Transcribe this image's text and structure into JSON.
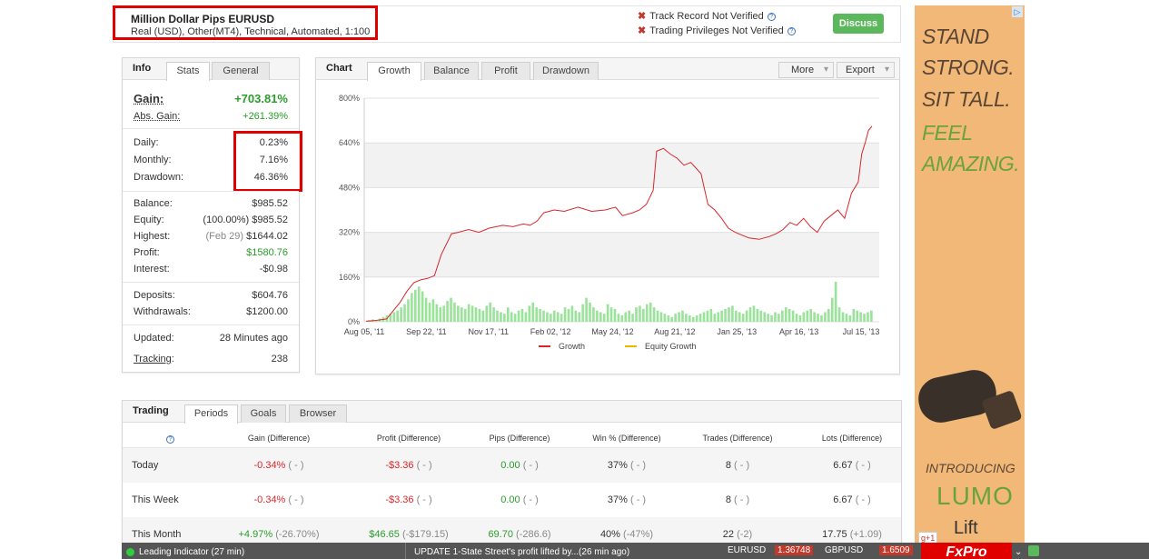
{
  "header": {
    "account_name": "Million Dollar Pips EURUSD",
    "account_details": "Real (USD), Other(MT4), Technical, Automated, 1:100",
    "track_record": "Track Record Not Verified",
    "trading_privileges": "Trading Privileges Not Verified",
    "discuss_label": "Discuss"
  },
  "info": {
    "title": "Info",
    "tabs": [
      "Stats",
      "General"
    ],
    "gain_label": "Gain:",
    "gain_value": "+703.81%",
    "abs_gain_label": "Abs. Gain:",
    "abs_gain_value": "+261.39%",
    "daily_label": "Daily:",
    "daily_value": "0.23%",
    "monthly_label": "Monthly:",
    "monthly_value": "7.16%",
    "drawdown_label": "Drawdown:",
    "drawdown_value": "46.36%",
    "balance_label": "Balance:",
    "balance_value": "$985.52",
    "equity_label": "Equity:",
    "equity_pct": "(100.00%)",
    "equity_value": "$985.52",
    "highest_label": "Highest:",
    "highest_date": "(Feb 29)",
    "highest_value": "$1644.02",
    "profit_label": "Profit:",
    "profit_value": "$1580.76",
    "interest_label": "Interest:",
    "interest_value": "-$0.98",
    "deposits_label": "Deposits:",
    "deposits_value": "$604.76",
    "withdrawals_label": "Withdrawals:",
    "withdrawals_value": "$1200.00",
    "updated_label": "Updated:",
    "updated_value": "28 Minutes ago",
    "tracking_label": "Tracking",
    "tracking_colon": ":",
    "tracking_value": "238"
  },
  "chart_panel": {
    "title": "Chart",
    "tabs": [
      "Growth",
      "Balance",
      "Profit",
      "Drawdown"
    ],
    "more_label": "More",
    "export_label": "Export"
  },
  "chart_data": {
    "type": "line",
    "y_ticks": [
      "800%",
      "640%",
      "480%",
      "320%",
      "160%",
      "0%"
    ],
    "x_ticks": [
      "Aug 05, '11",
      "Sep 22, '11",
      "Nov 17, '11",
      "Feb 02, '12",
      "May 24, '12",
      "Aug 21, '12",
      "Jan 25, '13",
      "Apr 16, '13",
      "Jul 15, '13"
    ],
    "ylim": [
      0,
      800
    ],
    "legend": [
      {
        "name": "Growth",
        "color": "#d9262b"
      },
      {
        "name": "Equity Growth",
        "color": "#f0b400"
      }
    ],
    "growth_series": [
      [
        0,
        2
      ],
      [
        3,
        5
      ],
      [
        6,
        10
      ],
      [
        8,
        40
      ],
      [
        10,
        70
      ],
      [
        12,
        110
      ],
      [
        14,
        140
      ],
      [
        16,
        150
      ],
      [
        18,
        155
      ],
      [
        20,
        165
      ],
      [
        22,
        240
      ],
      [
        24,
        290
      ],
      [
        25,
        315
      ],
      [
        27,
        320
      ],
      [
        30,
        330
      ],
      [
        33,
        320
      ],
      [
        36,
        335
      ],
      [
        40,
        345
      ],
      [
        43,
        340
      ],
      [
        46,
        350
      ],
      [
        48,
        345
      ],
      [
        50,
        360
      ],
      [
        52,
        390
      ],
      [
        55,
        400
      ],
      [
        58,
        395
      ],
      [
        62,
        410
      ],
      [
        66,
        395
      ],
      [
        70,
        400
      ],
      [
        73,
        410
      ],
      [
        75,
        380
      ],
      [
        78,
        390
      ],
      [
        80,
        400
      ],
      [
        82,
        420
      ],
      [
        84,
        470
      ],
      [
        85,
        610
      ],
      [
        87,
        620
      ],
      [
        89,
        600
      ],
      [
        91,
        585
      ],
      [
        93,
        560
      ],
      [
        95,
        570
      ],
      [
        98,
        530
      ],
      [
        100,
        420
      ],
      [
        102,
        400
      ],
      [
        104,
        370
      ],
      [
        106,
        335
      ],
      [
        108,
        320
      ],
      [
        110,
        310
      ],
      [
        112,
        300
      ],
      [
        115,
        295
      ],
      [
        118,
        305
      ],
      [
        120,
        315
      ],
      [
        122,
        330
      ],
      [
        124,
        355
      ],
      [
        126,
        345
      ],
      [
        128,
        370
      ],
      [
        130,
        340
      ],
      [
        132,
        320
      ],
      [
        134,
        360
      ],
      [
        136,
        380
      ],
      [
        138,
        400
      ],
      [
        140,
        370
      ],
      [
        142,
        460
      ],
      [
        144,
        500
      ],
      [
        145,
        600
      ],
      [
        146,
        640
      ],
      [
        147,
        685
      ],
      [
        148,
        700
      ]
    ],
    "volume_bars": [
      2,
      3,
      2,
      4,
      6,
      8,
      10,
      12,
      14,
      18,
      22,
      28,
      36,
      40,
      44,
      38,
      30,
      24,
      28,
      22,
      18,
      20,
      26,
      30,
      24,
      20,
      18,
      16,
      22,
      20,
      18,
      16,
      14,
      20,
      24,
      18,
      14,
      12,
      10,
      18,
      12,
      10,
      14,
      16,
      12,
      20,
      24,
      18,
      16,
      14,
      12,
      10,
      14,
      12,
      10,
      18,
      16,
      20,
      14,
      12,
      22,
      30,
      24,
      18,
      14,
      12,
      10,
      22,
      18,
      16,
      10,
      8,
      12,
      14,
      10,
      18,
      20,
      16,
      22,
      24,
      18,
      14,
      12,
      10,
      8,
      6,
      10,
      12,
      14,
      10,
      8,
      6,
      8,
      10,
      12,
      14,
      16,
      10,
      12,
      14,
      16,
      18,
      20,
      14,
      12,
      10,
      14,
      18,
      20,
      16,
      14,
      12,
      10,
      8,
      12,
      10,
      14,
      18,
      16,
      14,
      10,
      8,
      12,
      14,
      16,
      12,
      10,
      8,
      12,
      16,
      30,
      50,
      18,
      12,
      10,
      8,
      16,
      14,
      12,
      10,
      12,
      14
    ]
  },
  "trading": {
    "title": "Trading",
    "tabs": [
      "Periods",
      "Goals",
      "Browser"
    ],
    "headers": [
      "Gain (Difference)",
      "Profit (Difference)",
      "Pips (Difference)",
      "Win % (Difference)",
      "Trades (Difference)",
      "Lots (Difference)"
    ],
    "rows": [
      {
        "period": "Today",
        "gain": "-0.34%",
        "gain_d": "( - )",
        "profit": "-$3.36",
        "profit_d": "( - )",
        "pips": "0.00",
        "pips_d": "( - )",
        "win": "37%",
        "win_d": "( - )",
        "trades": "8",
        "trades_d": "( - )",
        "lots": "6.67",
        "lots_d": "( - )"
      },
      {
        "period": "This Week",
        "gain": "-0.34%",
        "gain_d": "( - )",
        "profit": "-$3.36",
        "profit_d": "( - )",
        "pips": "0.00",
        "pips_d": "( - )",
        "win": "37%",
        "win_d": "( - )",
        "trades": "8",
        "trades_d": "( - )",
        "lots": "6.67",
        "lots_d": "( - )"
      },
      {
        "period": "This Month",
        "gain": "+4.97%",
        "gain_d": "(-26.70%)",
        "profit": "$46.65",
        "profit_d": "(-$179.15)",
        "pips": "69.70",
        "pips_d": "(-286.6)",
        "win": "40%",
        "win_d": "(-47%)",
        "trades": "22",
        "trades_d": "(-2)",
        "lots": "17.75",
        "lots_d": "(+1.09)"
      }
    ]
  },
  "ad": {
    "lines": [
      "STAND",
      "STRONG.",
      "SIT TALL.",
      "FEEL",
      "AMAZING."
    ],
    "introducing": "INTRODUCING",
    "brand": "LUMO",
    "brand2": "Lift",
    "gplus": "g+1",
    "broker": "FxPro"
  },
  "ticker": {
    "indicator": "Leading Indicator (27 min)",
    "news": "UPDATE 1-State Street's profit lifted by...(26 min ago)",
    "pair1": "EURUSD",
    "price1": "1.36748",
    "pair2": "GBPUSD",
    "price2": "1.6509"
  }
}
